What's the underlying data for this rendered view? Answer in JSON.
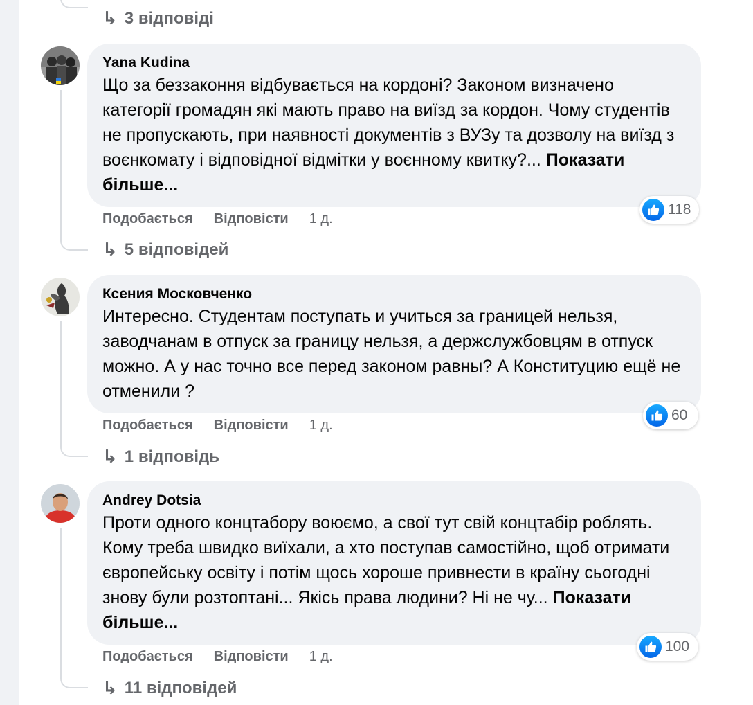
{
  "like_icon": "thumbs-up-icon",
  "reply_arrow_icon": "reply-arrow-icon",
  "accent_color": "#1877f2",
  "top_replies": {
    "label": "3 відповіді"
  },
  "comments": [
    {
      "author": "Yana Kudina",
      "text": "Що за беззаконня відбувається на кордоні? Законом визначено категорії громадян які мають право на виїзд за кордон. Чому студентів не пропускають, при наявності документів з ВУЗу та дозволу на виїзд з воєнкомату і відповідної відмітки у воєнному квитку?... ",
      "show_more": "Показати більше...",
      "like_label": "Подобається",
      "reply_label": "Відповісти",
      "time": "1 д.",
      "reactions": "118",
      "replies": "5 відповідей"
    },
    {
      "author": "Ксения Московченко",
      "text": "Интересно. Студентам поступать и учиться за границей нельзя, заводчанам в отпуск за границу нельзя, а держслужбовцям в отпуск можно. А у нас точно все перед законом равны? А Конституцию ещё не отменили ?",
      "show_more": "",
      "like_label": "Подобається",
      "reply_label": "Відповісти",
      "time": "1 д.",
      "reactions": "60",
      "replies": "1 відповідь"
    },
    {
      "author": "Andrey Dotsia",
      "text": "Проти одного концтабору воюємо, а свої тут свій концтабір роблять. Кому треба швидко виїхали, а хто поступав самостійно, щоб отримати європейську освіту і потім щось хороше привнести в країну сьогодні знову були розтоптані... Якісь права людини? Ні не чу... ",
      "show_more": "Показати більше...",
      "like_label": "Подобається",
      "reply_label": "Відповісти",
      "time": "1 д.",
      "reactions": "100",
      "replies": "11 відповідей"
    }
  ]
}
